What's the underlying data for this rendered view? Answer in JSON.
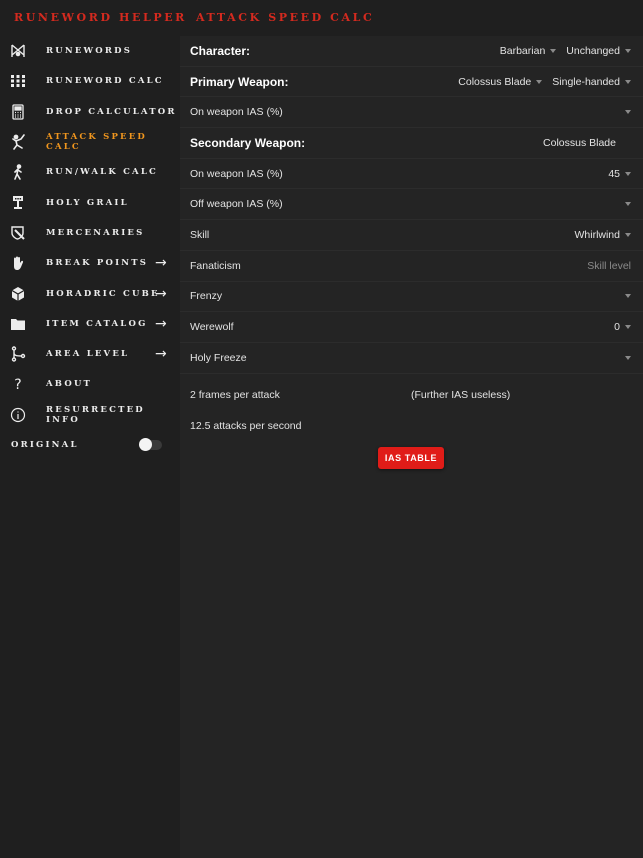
{
  "app": {
    "title": "Runeword Helper",
    "page_title": "Attack Speed Calc"
  },
  "colors": {
    "brand_red": "#d42a1f",
    "active_orange": "#f0961e",
    "button_red": "#e01c18"
  },
  "sidebar": {
    "items": [
      {
        "label": "Runewords",
        "icon": "runewords-icon",
        "arrow": false,
        "active": false
      },
      {
        "label": "Runeword Calc",
        "icon": "grid-icon",
        "arrow": false,
        "active": false
      },
      {
        "label": "Drop Calculator",
        "icon": "calculator-icon",
        "arrow": false,
        "active": false
      },
      {
        "label": "Attack Speed Calc",
        "icon": "attack-figure-icon",
        "arrow": false,
        "active": true
      },
      {
        "label": "Run/Walk Calc",
        "icon": "walking-icon",
        "arrow": false,
        "active": false
      },
      {
        "label": "Holy Grail",
        "icon": "grail-icon",
        "arrow": false,
        "active": false
      },
      {
        "label": "Mercenaries",
        "icon": "shield-sword-icon",
        "arrow": false,
        "active": false
      },
      {
        "label": "Break Points",
        "icon": "hand-icon",
        "arrow": true,
        "active": false
      },
      {
        "label": "Horadric Cube",
        "icon": "cube-icon",
        "arrow": true,
        "active": false
      },
      {
        "label": "Item Catalog",
        "icon": "folder-icon",
        "arrow": true,
        "active": false
      },
      {
        "label": "Area Level",
        "icon": "route-icon",
        "arrow": true,
        "active": false
      },
      {
        "label": "About",
        "icon": "question-icon",
        "arrow": false,
        "active": false
      },
      {
        "label": "Resurrected Info",
        "icon": "info-icon",
        "arrow": false,
        "active": false
      }
    ],
    "arrow_glyph": "→",
    "toggle": {
      "label": "Original",
      "on": false
    }
  },
  "main": {
    "character": {
      "label": "Character:",
      "class": "Barbarian",
      "form": "Unchanged"
    },
    "primary": {
      "label": "Primary Weapon:",
      "weapon": "Colossus Blade",
      "grip": "Single-handed"
    },
    "primary_ias": {
      "label": "On weapon IAS (%)",
      "value": ""
    },
    "secondary": {
      "label": "Secondary Weapon:",
      "weapon": "Colossus Blade"
    },
    "secondary_ias": {
      "label": "On weapon IAS (%)",
      "value": "45"
    },
    "off_weapon_ias": {
      "label": "Off weapon IAS (%)",
      "value": ""
    },
    "skill": {
      "label": "Skill",
      "value": "Whirlwind"
    },
    "fanaticism": {
      "label": "Fanaticism",
      "placeholder": "Skill level"
    },
    "frenzy": {
      "label": "Frenzy",
      "value": ""
    },
    "werewolf": {
      "label": "Werewolf",
      "value": "0"
    },
    "holy_freeze": {
      "label": "Holy Freeze",
      "value": ""
    },
    "results": {
      "frames": "2 frames per attack",
      "note": "(Further IAS useless)",
      "aps": "12.5 attacks per second"
    },
    "ias_table_button": "IAS TABLE"
  }
}
